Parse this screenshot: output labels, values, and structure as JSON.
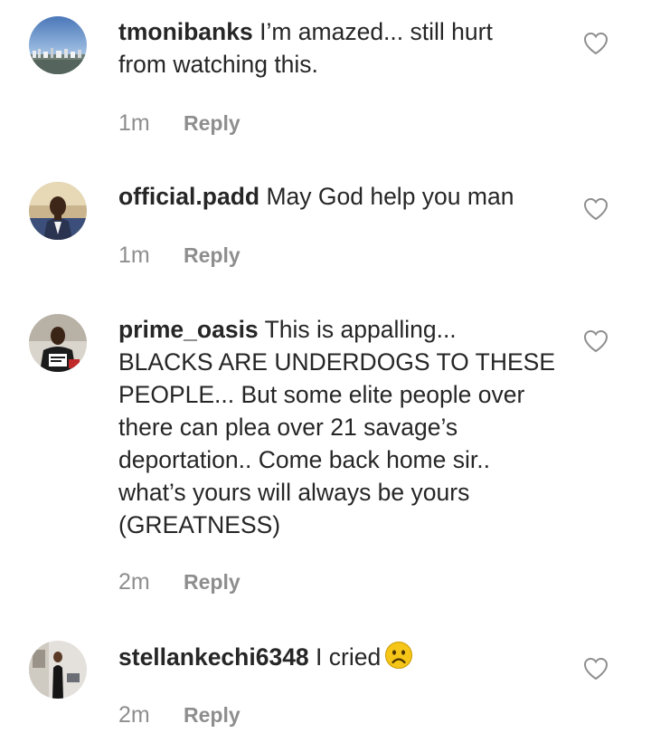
{
  "comments": [
    {
      "username": "tmonibanks",
      "text": "I’m amazed... still hurt\nfrom watching this.",
      "time": "1m",
      "reply_label": "Reply",
      "avatar_icon": "landscape-avatar-icon"
    },
    {
      "username": "official.padd",
      "text": "May God help you man",
      "time": "1m",
      "reply_label": "Reply",
      "avatar_icon": "person-avatar-icon"
    },
    {
      "username": "prime_oasis",
      "text": "This is appalling...\nBLACKS ARE UNDERDOGS TO THESE\nPEOPLE... But some elite people over\nthere can plea over 21 savage’s\ndeportation.. Come back home sir..\nwhat’s yours will always be yours\n(GREATNESS)",
      "time": "2m",
      "reply_label": "Reply",
      "avatar_icon": "person-avatar-icon"
    },
    {
      "username": "stellankechi6348",
      "text": "I cried",
      "time": "2m",
      "reply_label": "Reply",
      "avatar_icon": "person-avatar-icon",
      "emoji": "frowning-face-emoji"
    }
  ],
  "like_icon": "heart-outline-icon",
  "colors": {
    "text": "#262626",
    "meta": "#8e8e8e",
    "background": "#ffffff",
    "emoji_yellow": "#f5c518"
  }
}
